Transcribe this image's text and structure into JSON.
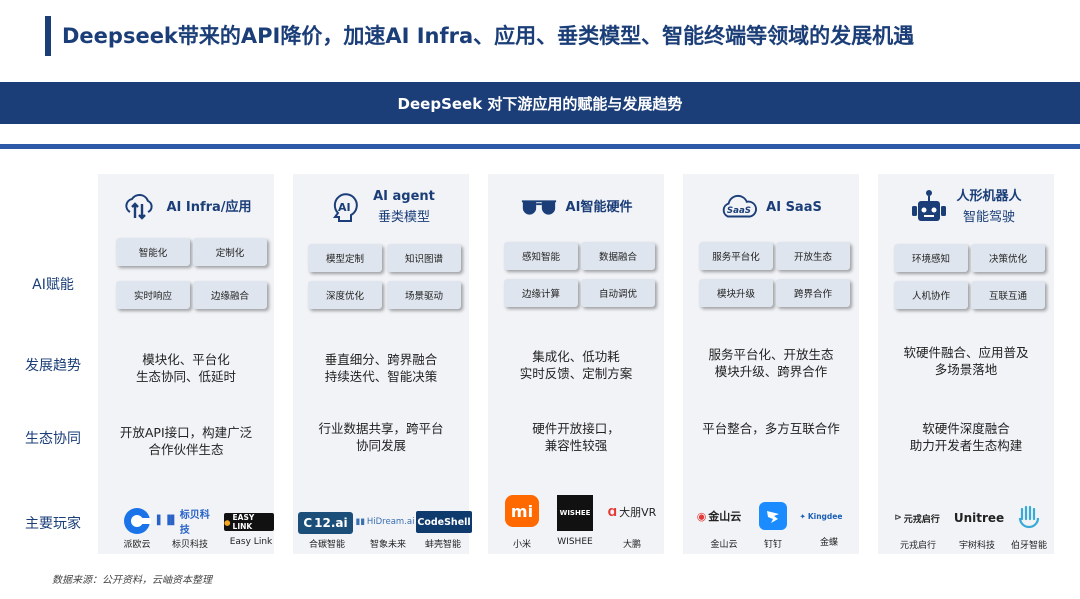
{
  "title": "Deepseek带来的API降价，加速AI Infra、应用、垂类模型、智能终端等领域的发展机遇",
  "banner": "DeepSeek 对下游应用的赋能与发展趋势",
  "row_labels": {
    "enable": "AI赋能",
    "trend": "发展趋势",
    "eco": "生态协同",
    "players": "主要玩家"
  },
  "columns": [
    {
      "head": [
        "AI Infra/应用"
      ],
      "icon": "cloud-transfer-icon",
      "chips": [
        "智能化",
        "定制化",
        "实时响应",
        "边缘融合"
      ],
      "trend": [
        "模块化、平台化",
        "生态协同、低延时"
      ],
      "eco": [
        "开放API接口，构建广泛",
        "合作伙伴生态"
      ],
      "players": [
        {
          "logo": "派欧云",
          "caption": "派欧云"
        },
        {
          "logo": "标贝科技",
          "caption": "标贝科技"
        },
        {
          "logo": "EASY LINK",
          "caption": "Easy Link"
        }
      ]
    },
    {
      "head": [
        "AI agent",
        "垂类模型"
      ],
      "icon": "ai-head-icon",
      "chips": [
        "模型定制",
        "知识图谱",
        "深度优化",
        "场景驱动"
      ],
      "trend": [
        "垂直细分、跨界融合",
        "持续迭代、智能决策"
      ],
      "eco": [
        "行业数据共享，跨平台",
        "协同发展"
      ],
      "players": [
        {
          "logo": "12.ai",
          "caption": "合碳智能"
        },
        {
          "logo": "HiDream.ai",
          "caption": "智象未来"
        },
        {
          "logo": "CodeShell",
          "caption": "蚌壳智能"
        }
      ]
    },
    {
      "head": [
        "AI智能硬件"
      ],
      "icon": "smart-glasses-icon",
      "chips": [
        "感知智能",
        "数据融合",
        "边缘计算",
        "自动调优"
      ],
      "trend": [
        "集成化、低功耗",
        "实时反馈、定制方案"
      ],
      "eco": [
        "硬件开放接口，",
        "兼容性较强"
      ],
      "players": [
        {
          "logo": "mi",
          "caption": "小米"
        },
        {
          "logo": "WISHEE",
          "caption": "WISHEE"
        },
        {
          "logo": "大朋VR",
          "caption": "大鹏"
        }
      ]
    },
    {
      "head": [
        "AI SaaS"
      ],
      "icon": "saas-cloud-icon",
      "chips": [
        "服务平台化",
        "开放生态",
        "模块升级",
        "跨界合作"
      ],
      "trend": [
        "服务平台化、开放生态",
        "模块升级、跨界合作"
      ],
      "eco": [
        "平台整合，多方互联合作"
      ],
      "players": [
        {
          "logo": "金山云",
          "caption": "金山云"
        },
        {
          "logo": "钉钉",
          "caption": "钉钉"
        },
        {
          "logo": "Kingdee",
          "caption": "金蝶"
        }
      ]
    },
    {
      "head": [
        "人形机器人",
        "智能驾驶"
      ],
      "icon": "robot-icon",
      "chips": [
        "环境感知",
        "决策优化",
        "人机协作",
        "互联互通"
      ],
      "trend": [
        "软硬件融合、应用普及",
        "多场景落地"
      ],
      "eco": [
        "软硬件深度融合",
        "助力开发者生态构建"
      ],
      "players": [
        {
          "logo": "元戎启行",
          "caption": "元戎启行"
        },
        {
          "logo": "Unitree",
          "caption": "宇树科技"
        },
        {
          "logo": "伯牙",
          "caption": "伯牙智能"
        }
      ]
    }
  ],
  "source": "数据来源：公开资料，云岫资本整理",
  "colors": {
    "navy": "#1b3e78",
    "chip": "#dfe5ee",
    "panel": "#f1f3f7"
  }
}
